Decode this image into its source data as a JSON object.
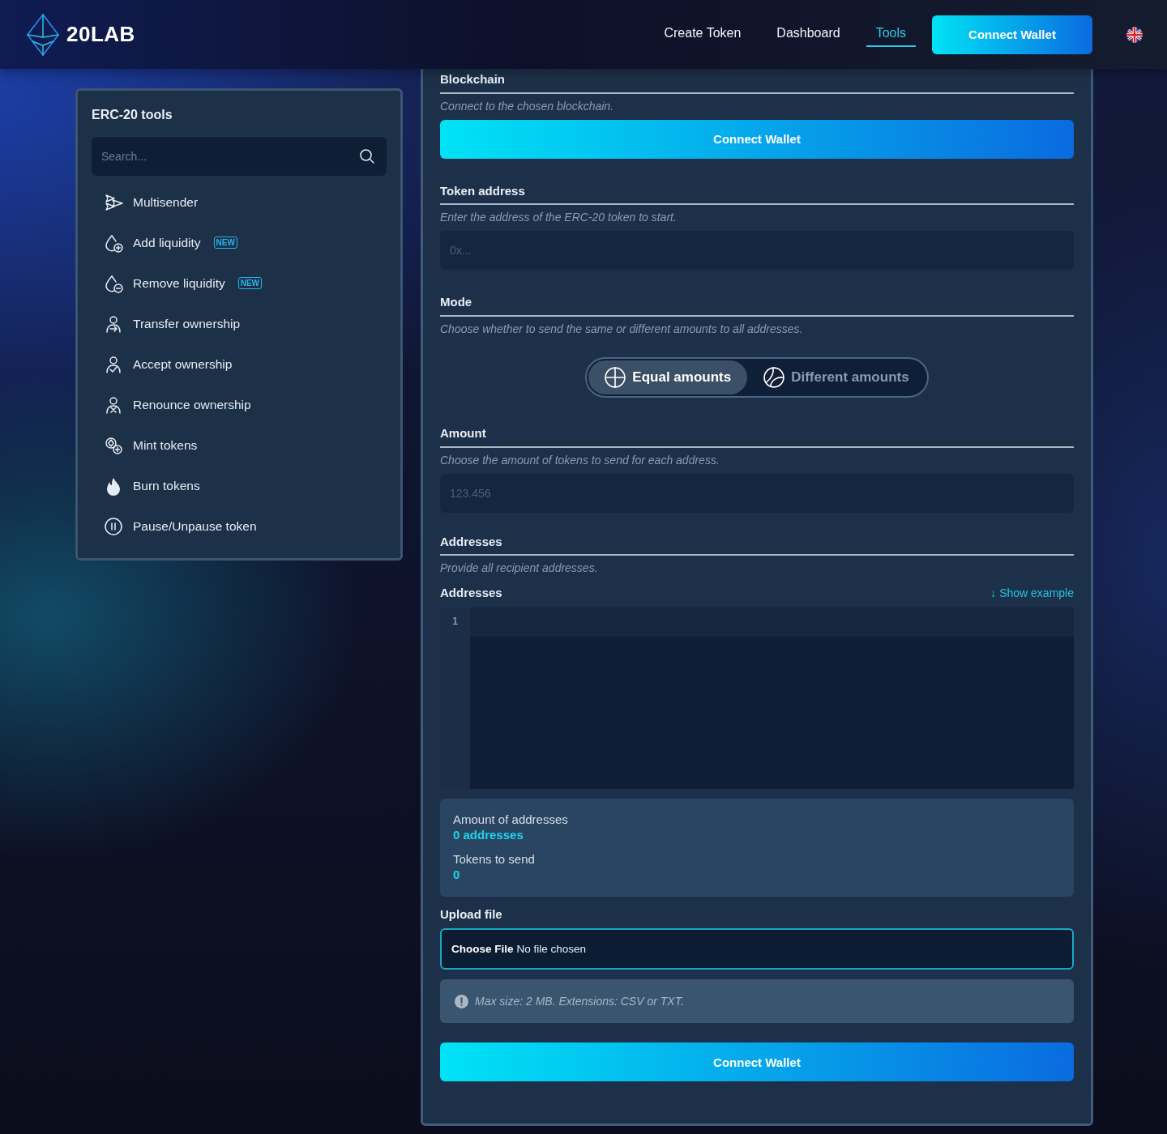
{
  "header": {
    "logo": "20LAB",
    "nav": [
      {
        "label": "Create Token",
        "selected": false
      },
      {
        "label": "Dashboard",
        "selected": false
      },
      {
        "label": "Tools",
        "selected": true
      }
    ],
    "connect_button": "Connect Wallet"
  },
  "sidebar": {
    "title": "ERC-20 tools",
    "search": {
      "placeholder": "Search..."
    },
    "items": [
      {
        "label": "Multisender"
      },
      {
        "label": "Add liquidity",
        "badge": "NEW"
      },
      {
        "label": "Remove liquidity",
        "badge": "NEW"
      },
      {
        "label": "Transfer ownership"
      },
      {
        "label": "Accept ownership"
      },
      {
        "label": "Renounce ownership"
      },
      {
        "label": "Mint tokens"
      },
      {
        "label": "Burn tokens"
      },
      {
        "label": "Pause/Unpause token"
      }
    ]
  },
  "form": {
    "blockchain": {
      "label": "Blockchain",
      "hint": "Connect to the chosen blockchain.",
      "button": "Connect Wallet"
    },
    "token_address": {
      "label": "Token address",
      "hint": "Enter the address of the ERC-20 token to start.",
      "placeholder": "0x..."
    },
    "mode": {
      "label": "Mode",
      "hint": "Choose whether to send the same or different amounts to all addresses.",
      "options": [
        {
          "label": "Equal amounts",
          "selected": true
        },
        {
          "label": "Different amounts",
          "selected": false
        }
      ]
    },
    "amount": {
      "label": "Amount",
      "hint": "Choose the amount of tokens to send for each address.",
      "placeholder": "123.456"
    },
    "addresses": {
      "label": "Addresses",
      "hint": "Provide all recipient addresses.",
      "editor_label": "Addresses",
      "show_example": "↓ Show example",
      "line_numbers": [
        "1"
      ]
    },
    "summary": [
      {
        "label": "Amount of addresses",
        "value": "0 addresses"
      },
      {
        "label": "Tokens to send",
        "value": "0"
      }
    ],
    "upload": {
      "label": "Upload file",
      "button": "Choose File",
      "status": "No file chosen"
    },
    "info": "Max size: 2 MB. Extensions: CSV or TXT.",
    "submit": "Connect Wallet"
  }
}
